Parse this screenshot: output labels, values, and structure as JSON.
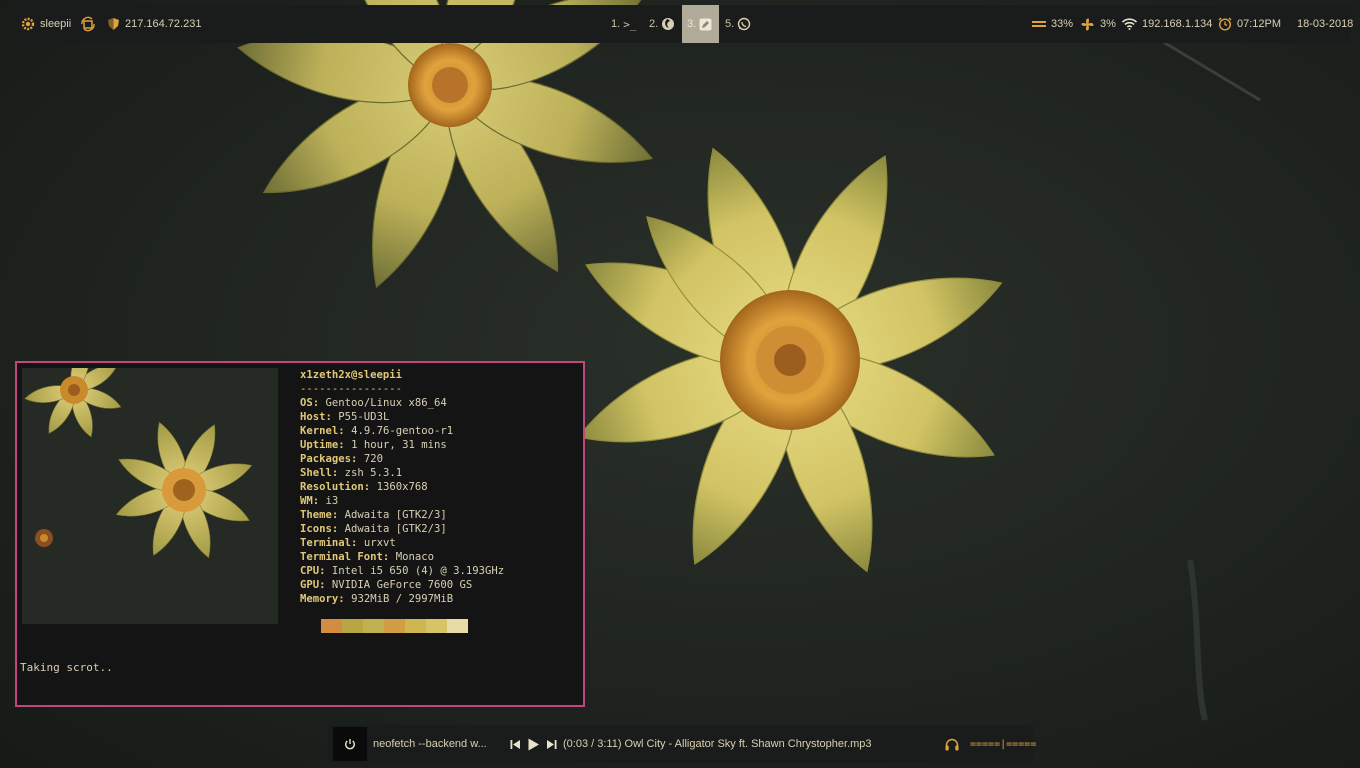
{
  "topbar": {
    "host": "sleepii",
    "ip": "217.164.72.231",
    "workspaces": [
      {
        "label": "1.",
        "icon": "terminal-icon",
        "glyph": ">_"
      },
      {
        "label": "2.",
        "icon": "firefox-icon"
      },
      {
        "label": "3.",
        "icon": "pencil-icon",
        "active": true
      },
      {
        "label": "5.",
        "icon": "whatsapp-icon"
      }
    ],
    "memory": "33%",
    "cpu": "3%",
    "local_ip": "192.168.1.134",
    "time": "07:12PM",
    "date": "18-03-2018"
  },
  "terminal": {
    "title": "x1zeth2x@sleepii",
    "separator": "----------------",
    "info": [
      {
        "k": "OS",
        "v": "Gentoo/Linux x86_64"
      },
      {
        "k": "Host",
        "v": "P55-UD3L"
      },
      {
        "k": "Kernel",
        "v": "4.9.76-gentoo-r1"
      },
      {
        "k": "Uptime",
        "v": "1 hour, 31 mins"
      },
      {
        "k": "Packages",
        "v": "720"
      },
      {
        "k": "Shell",
        "v": "zsh 5.3.1"
      },
      {
        "k": "Resolution",
        "v": "1360x768"
      },
      {
        "k": "WM",
        "v": "i3"
      },
      {
        "k": "Theme",
        "v": "Adwaita [GTK2/3]"
      },
      {
        "k": "Icons",
        "v": "Adwaita [GTK2/3]"
      },
      {
        "k": "Terminal",
        "v": "urxvt"
      },
      {
        "k": "Terminal Font",
        "v": "Monaco"
      },
      {
        "k": "CPU",
        "v": "Intel i5 650 (4) @ 3.193GHz"
      },
      {
        "k": "GPU",
        "v": "NVIDIA GeForce 7600 GS"
      },
      {
        "k": "Memory",
        "v": "932MiB / 2997MiB"
      }
    ],
    "palette": [
      "#d38d42",
      "#b9a542",
      "#c0b04f",
      "#d29e45",
      "#cfb651",
      "#d6c466",
      "#e8dca6"
    ],
    "prompt": "Taking scrot.."
  },
  "bottombar": {
    "window_title": "neofetch --backend w...",
    "player": "(0:03 / 3:11) Owl City - Alligator Sky ft. Shawn Chrystopher.mp3",
    "volume": "=====|====="
  },
  "colors": {
    "accent": "#e0a23c",
    "border": "#c2457e",
    "bar": "#1a1c1b"
  }
}
